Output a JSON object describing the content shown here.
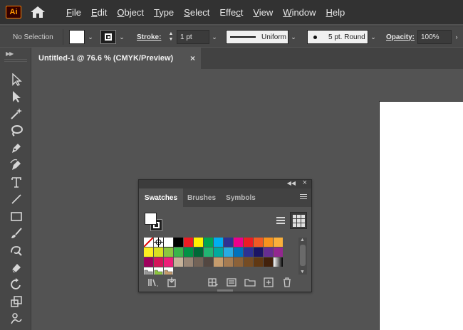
{
  "app": {
    "logo_text": "Ai",
    "brand_color": "#ff9a00"
  },
  "menu": {
    "items": [
      {
        "underline": "F",
        "rest": "ile"
      },
      {
        "underline": "E",
        "rest": "dit"
      },
      {
        "underline": "O",
        "rest": "bject"
      },
      {
        "underline": "T",
        "rest": "ype"
      },
      {
        "underline": "S",
        "rest": "elect"
      },
      {
        "pre": "Effe",
        "underline": "c",
        "rest": "t"
      },
      {
        "underline": "V",
        "rest": "iew"
      },
      {
        "underline": "W",
        "rest": "indow"
      },
      {
        "underline": "H",
        "rest": "elp"
      }
    ]
  },
  "control": {
    "selection_status": "No Selection",
    "stroke_label": "Stroke:",
    "stroke_weight": "1 pt",
    "stroke_profile": "Uniform",
    "brush": "5 pt. Round",
    "opacity_label": "Opacity:",
    "opacity_value": "100%"
  },
  "document": {
    "tab_title": "Untitled-1 @ 76.6 % (CMYK/Preview)",
    "close_glyph": "×"
  },
  "swatches_panel": {
    "tabs": [
      "Swatches",
      "Brushes",
      "Symbols"
    ],
    "active_tab": "Swatches",
    "rows": [
      [
        "none",
        "registration",
        "#ffffff",
        "#000000",
        "#ed1c24",
        "#fff200",
        "#00a651",
        "#00aeef",
        "#2e3192",
        "#ec008c",
        "#ed1c24",
        "#f15a24",
        "#f7931e",
        "#fbb03b"
      ],
      [
        "#fcee21",
        "#d9e021",
        "#8cc63f",
        "#39b54a",
        "#009245",
        "#006837",
        "#22b573",
        "#00a99d",
        "#29abe2",
        "#0071bc",
        "#2e3192",
        "#1b1464",
        "#662d91",
        "#93278f"
      ],
      [
        "#9e005d",
        "#d4145a",
        "#ed1e79",
        "#c7b299",
        "#998675",
        "#736357",
        "#534741",
        "#c69c6d",
        "#a67c52",
        "#8c6239",
        "#754c24",
        "#603813",
        "#42210b",
        "gradient-bw"
      ],
      [
        "folder-grays",
        "folder-brights",
        "folder-earth"
      ]
    ]
  }
}
